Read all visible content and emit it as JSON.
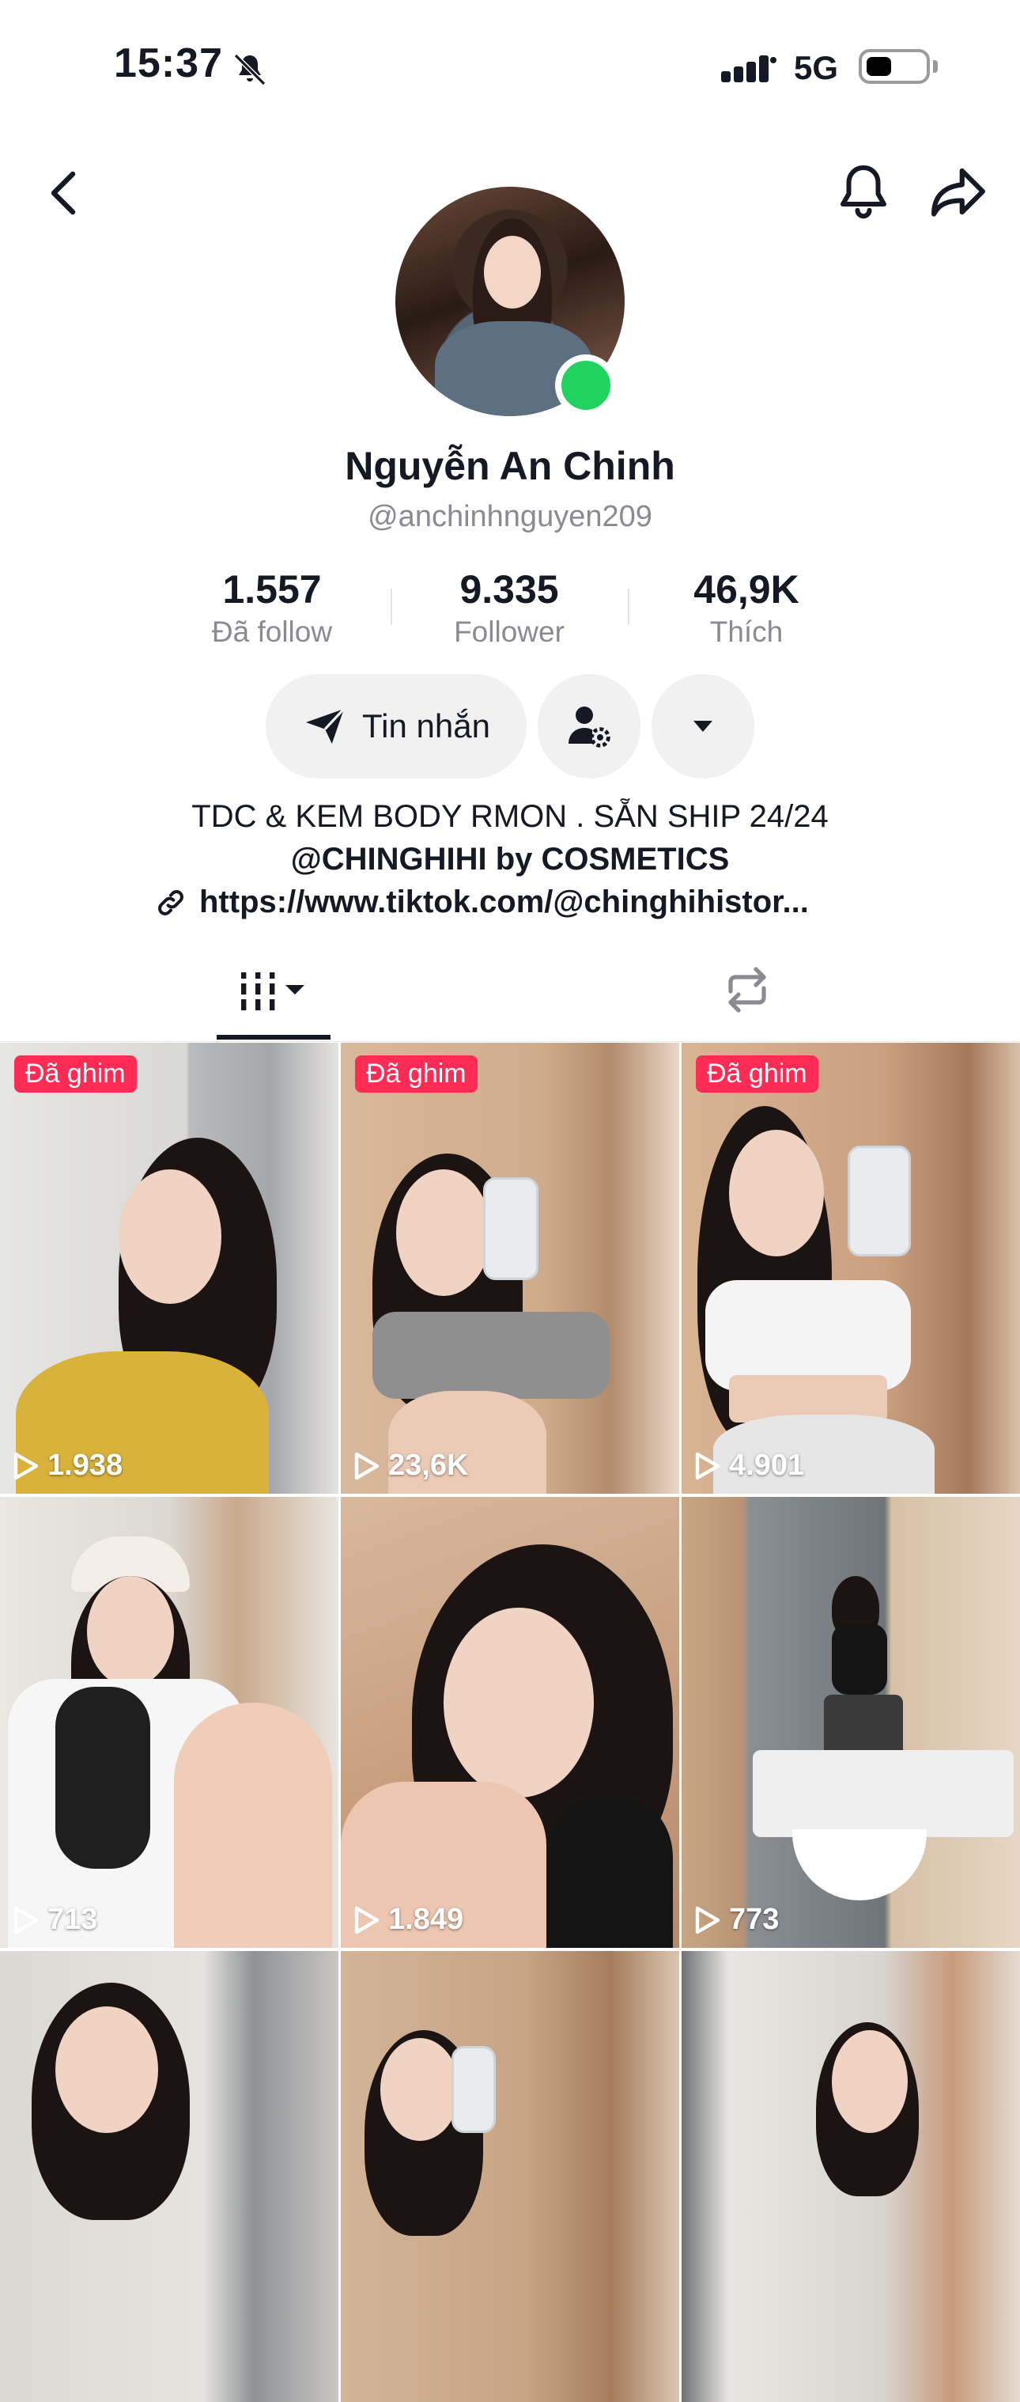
{
  "status_bar": {
    "time": "15:37",
    "mute_icon": "bell-slash-icon",
    "signal_icon": "cellular-signal-icon",
    "network": "5G",
    "battery_level": 0.45
  },
  "header": {
    "back_icon": "chevron-left-icon",
    "bell_icon": "bell-icon",
    "share_icon": "share-arrow-icon"
  },
  "profile": {
    "name": "Nguyễn An Chinh",
    "handle": "@anchinhnguyen209",
    "online": true,
    "online_color": "#20d35f"
  },
  "stats": [
    {
      "value": "1.557",
      "label": "Đã follow"
    },
    {
      "value": "9.335",
      "label": "Follower"
    },
    {
      "value": "46,9K",
      "label": "Thích"
    }
  ],
  "actions": {
    "message_label": "Tin nhắn",
    "message_icon": "paper-plane-icon",
    "add_friend_icon": "user-gear-icon",
    "more_icon": "caret-down-icon"
  },
  "bio": {
    "line1": "TDC & KEM BODY RMON . SẴN SHIP 24/24",
    "line2": "@CHINGHIHI by COSMETICS",
    "link_icon": "link-icon",
    "link": "https://www.tiktok.com/@chinghihistor..."
  },
  "tabs": [
    {
      "name": "videos",
      "icon": "grid-bars-icon",
      "active": true
    },
    {
      "name": "reposts",
      "icon": "repost-icon",
      "active": false
    }
  ],
  "accent_color": "#fe2c55",
  "videos": [
    {
      "pinned_label": "Đã ghim",
      "views": "1.938"
    },
    {
      "pinned_label": "Đã ghim",
      "views": "23,6K"
    },
    {
      "pinned_label": "Đã ghim",
      "views": "4.901"
    },
    {
      "pinned_label": "",
      "views": "713"
    },
    {
      "pinned_label": "",
      "views": "1.849"
    },
    {
      "pinned_label": "",
      "views": "773"
    },
    {
      "pinned_label": "",
      "views": ""
    },
    {
      "pinned_label": "",
      "views": ""
    },
    {
      "pinned_label": "",
      "views": ""
    }
  ]
}
